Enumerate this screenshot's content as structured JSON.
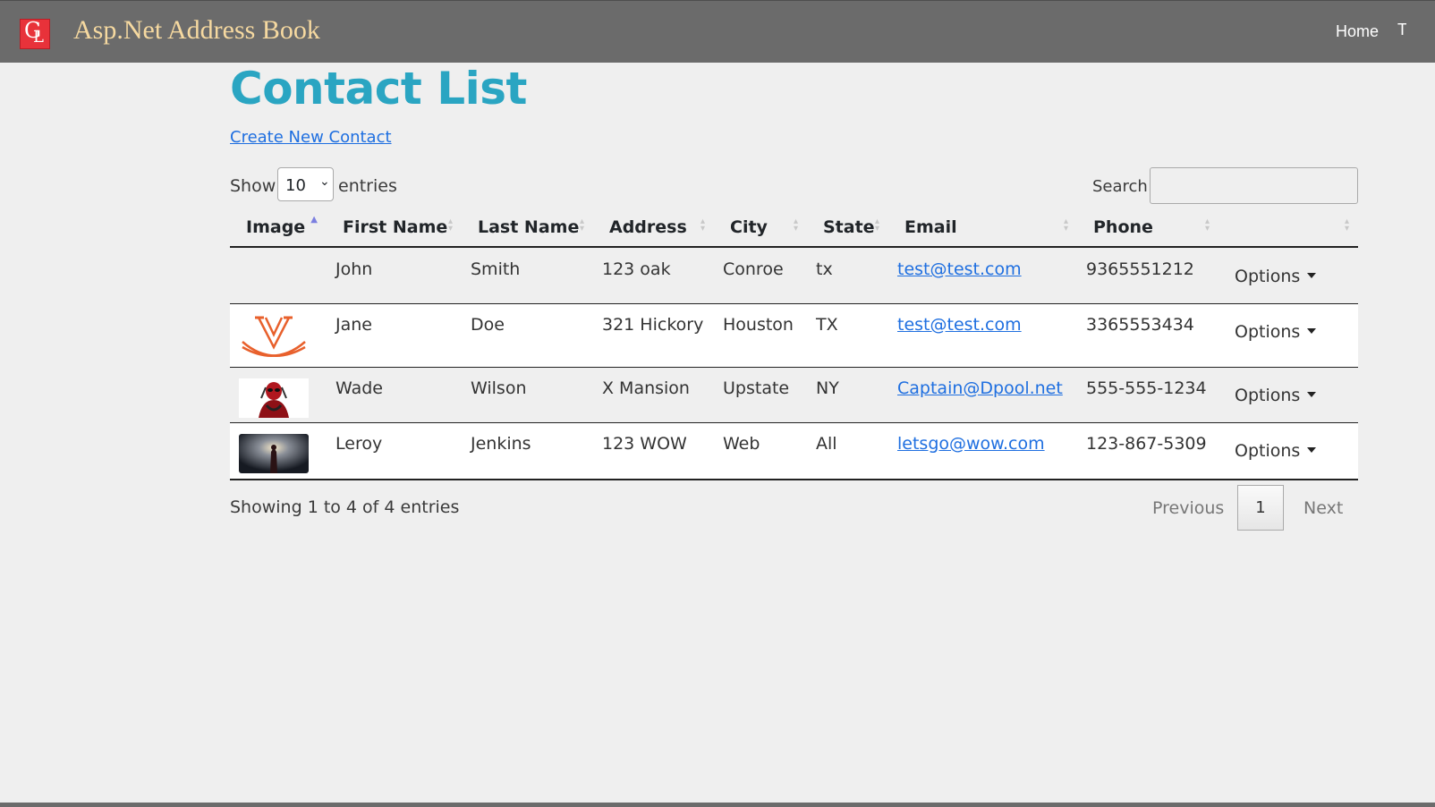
{
  "nav": {
    "logo_letters": [
      "G",
      "L"
    ],
    "title": "Asp.Net Address Book",
    "home": "Home",
    "more": "T"
  },
  "page": {
    "title": "Contact List",
    "create_link": "Create New Contact"
  },
  "controls": {
    "show_label": "Show",
    "entries_value": "10",
    "entries_label": "entries",
    "search_label": "Search:",
    "search_value": ""
  },
  "table": {
    "columns": [
      "Image",
      "First Name",
      "Last Name",
      "Address",
      "City",
      "State",
      "Email",
      "Phone",
      ""
    ],
    "sorted_column": "Image",
    "rows": [
      {
        "image": "",
        "first": "John",
        "last": "Smith",
        "address": "123 oak",
        "city": "Conroe",
        "state": "tx",
        "email": "test@test.com",
        "phone": "9365551212",
        "options": "Options"
      },
      {
        "image": "v-swords-logo",
        "first": "Jane",
        "last": "Doe",
        "address": "321 Hickory",
        "city": "Houston",
        "state": "TX",
        "email": "test@test.com",
        "phone": "3365553434",
        "options": "Options"
      },
      {
        "image": "deadpool-photo",
        "first": "Wade",
        "last": "Wilson",
        "address": "X Mansion",
        "city": "Upstate",
        "state": "NY",
        "email": "Captain@Dpool.net",
        "phone": "555-555-1234",
        "options": "Options"
      },
      {
        "image": "dark-stage-photo",
        "first": "Leroy",
        "last": "Jenkins",
        "address": "123 WOW",
        "city": "Web",
        "state": "All",
        "email": "letsgo@wow.com",
        "phone": "123-867-5309",
        "options": "Options"
      }
    ]
  },
  "footer": {
    "info": "Showing 1 to 4 of 4 entries",
    "previous": "Previous",
    "page": "1",
    "next": "Next"
  },
  "colors": {
    "navbar": "#6b6b6b",
    "brand_text": "#f6d9a0",
    "title": "#2aa5c2",
    "link": "#1f6fe0"
  }
}
